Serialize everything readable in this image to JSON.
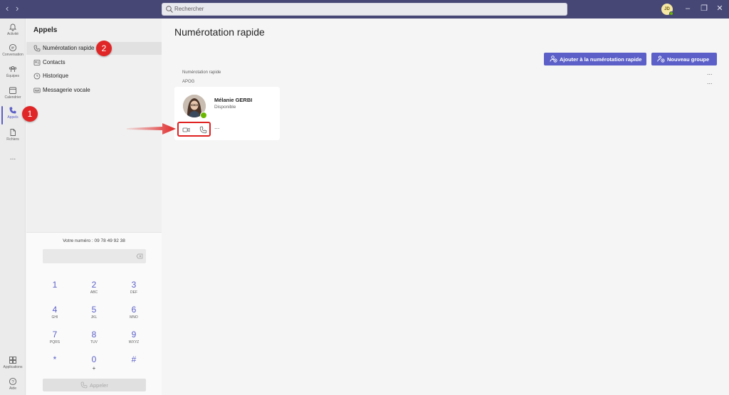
{
  "titlebar": {
    "search_placeholder": "Rechercher",
    "avatar_initials": "JD"
  },
  "rail": {
    "items": [
      {
        "label": "Activité",
        "icon": "bell-icon"
      },
      {
        "label": "Conversation",
        "icon": "chat-icon"
      },
      {
        "label": "Équipes",
        "icon": "teams-icon"
      },
      {
        "label": "Calendrier",
        "icon": "calendar-icon"
      },
      {
        "label": "Appels",
        "icon": "phone-icon"
      },
      {
        "label": "Fichiers",
        "icon": "file-icon"
      },
      {
        "label": "...",
        "icon": "more-icon"
      }
    ],
    "bottom": [
      {
        "label": "Applications",
        "icon": "apps-icon"
      },
      {
        "label": "Aide",
        "icon": "help-icon"
      }
    ]
  },
  "panel": {
    "title": "Appels",
    "items": [
      {
        "label": "Numérotation rapide",
        "icon": "phone-icon"
      },
      {
        "label": "Contacts",
        "icon": "contact-card-icon"
      },
      {
        "label": "Historique",
        "icon": "clock-icon"
      },
      {
        "label": "Messagerie vocale",
        "icon": "voicemail-icon"
      }
    ]
  },
  "dialpad": {
    "your_number": "Votre numéro : 09 78 49 92 38",
    "keys": [
      {
        "digit": "1",
        "letters": ""
      },
      {
        "digit": "2",
        "letters": "ABC"
      },
      {
        "digit": "3",
        "letters": "DEF"
      },
      {
        "digit": "4",
        "letters": "GHI"
      },
      {
        "digit": "5",
        "letters": "JKL"
      },
      {
        "digit": "6",
        "letters": "MNO"
      },
      {
        "digit": "7",
        "letters": "PQRS"
      },
      {
        "digit": "8",
        "letters": "TUV"
      },
      {
        "digit": "9",
        "letters": "WXYZ"
      },
      {
        "digit": "*",
        "letters": ""
      },
      {
        "digit": "0",
        "letters": "+"
      },
      {
        "digit": "#",
        "letters": ""
      }
    ],
    "call_label": "Appeler"
  },
  "main": {
    "title": "Numérotation rapide",
    "add_button": "Ajouter à la numérotation rapide",
    "new_group_button": "Nouveau groupe",
    "sections": [
      {
        "label": "Numérotation rapide",
        "more": "..."
      },
      {
        "label": "APOG",
        "more": "..."
      }
    ],
    "contact": {
      "name": "Mélanie GERBI",
      "presence": "Disponible",
      "more": "..."
    }
  },
  "annotations": {
    "badge_1": "1",
    "badge_2": "2",
    "color": "#e02626"
  },
  "colors": {
    "accent": "#5b5fc7",
    "titlebar": "#464775",
    "available": "#6bb700"
  }
}
